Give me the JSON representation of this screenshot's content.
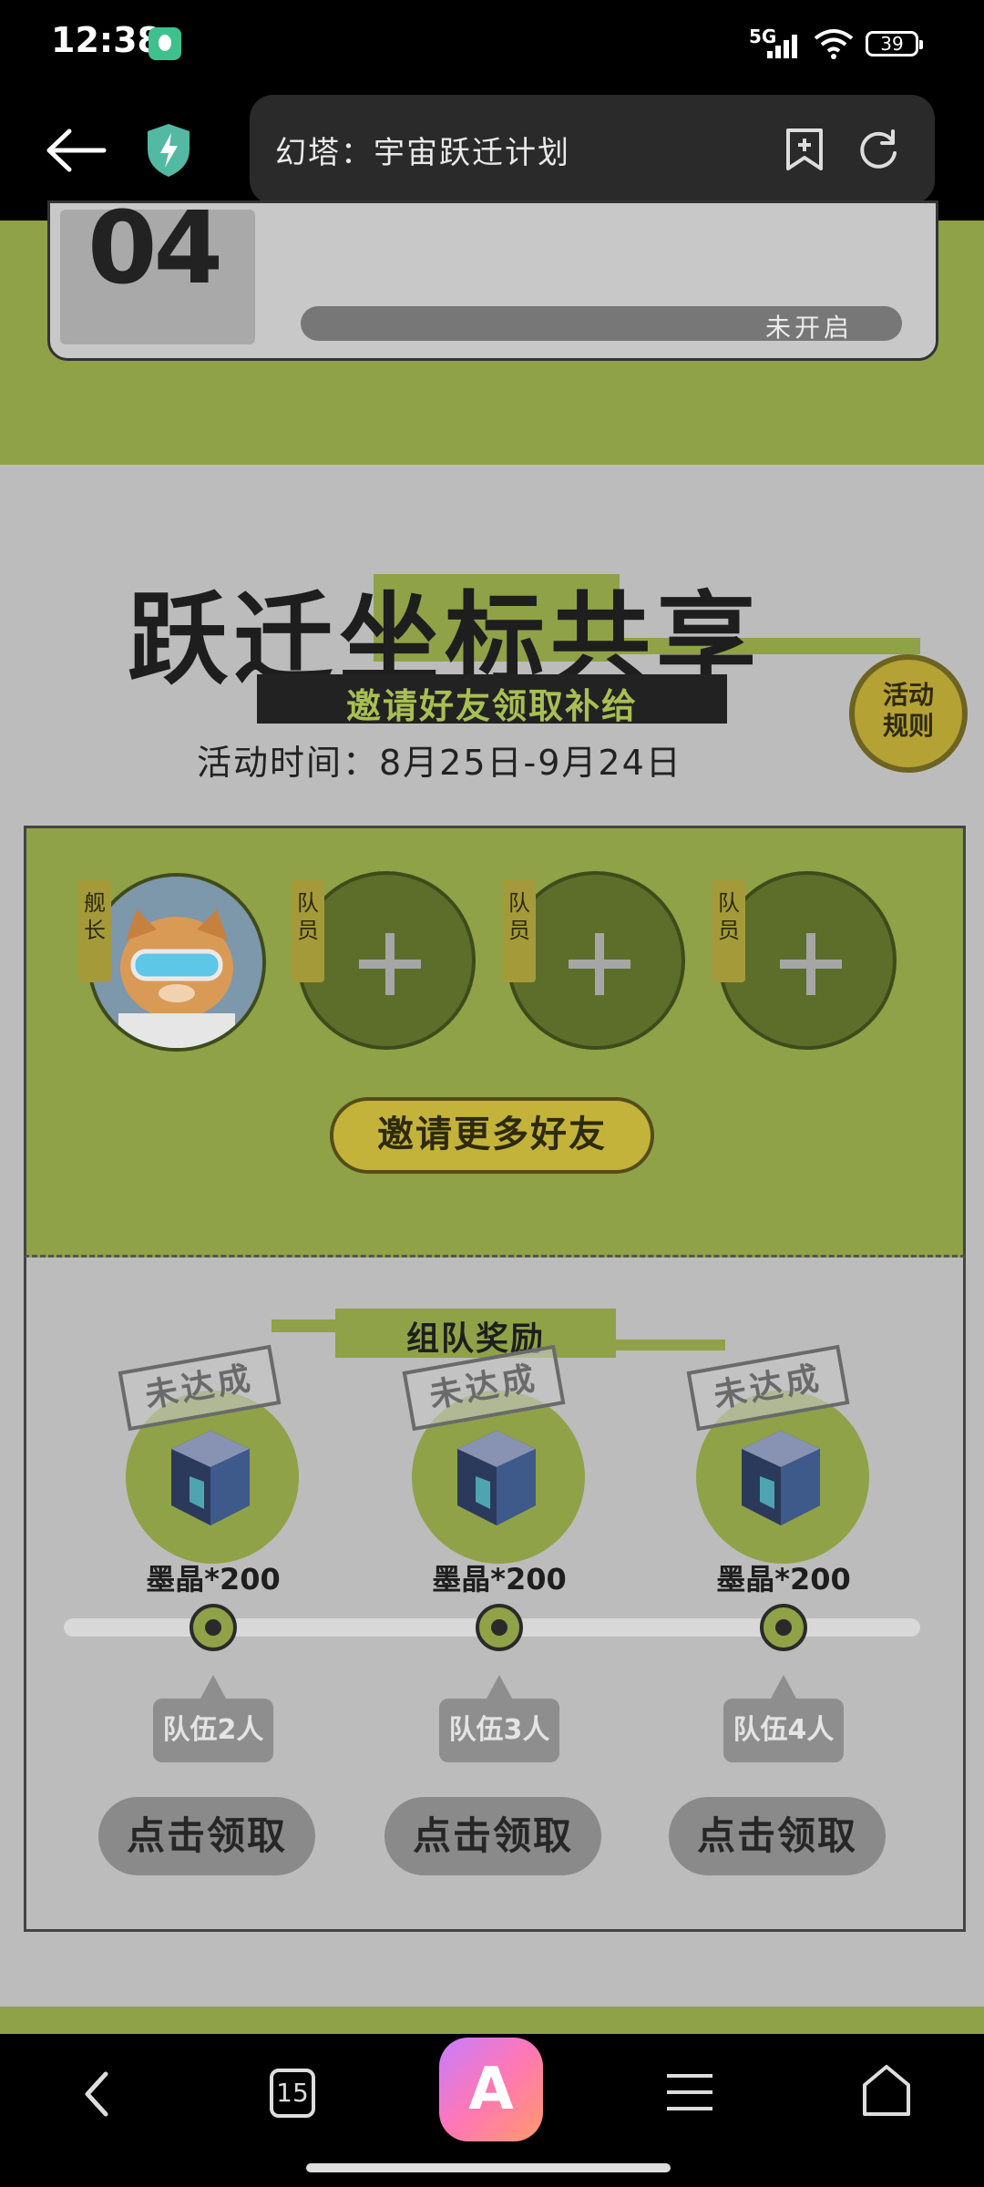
{
  "status_bar": {
    "time": "12:38",
    "network": "5G",
    "battery": "39"
  },
  "browser": {
    "url_title": "幻塔：宇宙跃迁计划"
  },
  "card04": {
    "number": "04",
    "status": "未开启"
  },
  "event": {
    "title": "跃迁坐标共享",
    "subtitle": "邀请好友领取补给",
    "date": "活动时间：8月25日-9月24日",
    "rules_line1": "活动",
    "rules_line2": "规则"
  },
  "team": {
    "captain_tag": "舰长",
    "member_tag": "队员",
    "invite_button": "邀请更多好友"
  },
  "rewards": {
    "title": "组队奖励",
    "stamp": "未达成",
    "tiers": [
      {
        "label": "墨晶*200",
        "team_count": "队伍2人",
        "claim": "点击领取"
      },
      {
        "label": "墨晶*200",
        "team_count": "队伍3人",
        "claim": "点击领取"
      },
      {
        "label": "墨晶*200",
        "team_count": "队伍4人",
        "claim": "点击领取"
      }
    ]
  },
  "nav": {
    "tabs_count": "15"
  },
  "colors": {
    "accent_green": "#8fa247",
    "gold": "#c4b33a",
    "dark": "#1e1e1e"
  }
}
